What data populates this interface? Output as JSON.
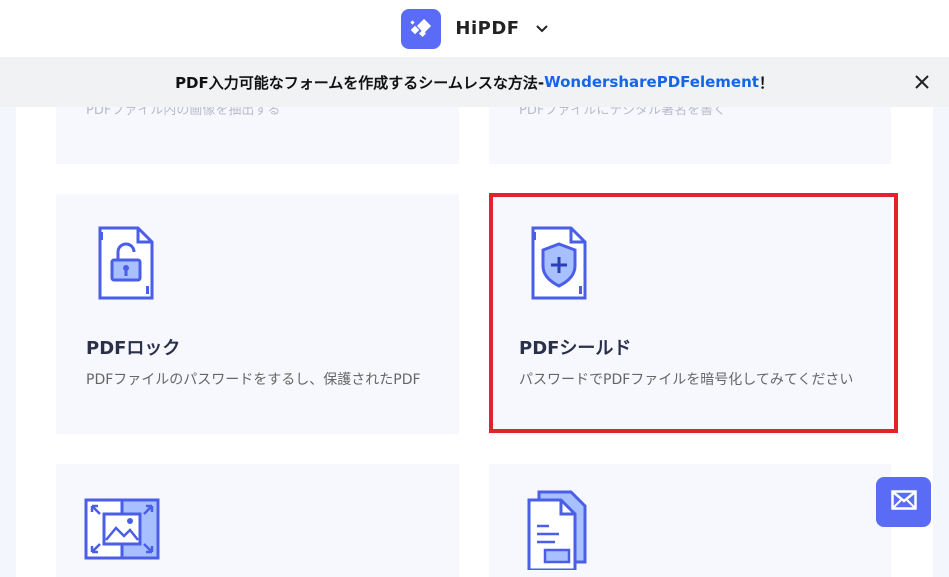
{
  "header": {
    "brand_name": "HiPDF"
  },
  "banner": {
    "text_prefix": "PDF入力可能なフォームを作成するシームレスな方法-",
    "link_text": "WondersharePDFelement",
    "text_suffix": "！"
  },
  "cards": {
    "top_left_desc": "PDFファイル内の画像を抽出する",
    "top_right_desc": "PDFファイルにデジタル署名を書く",
    "lock": {
      "title": "PDFロック",
      "desc": "PDFファイルのパスワードをするし、保護されたPDF"
    },
    "shield": {
      "title": "PDFシールド",
      "desc": "パスワードでPDFファイルを暗号化してみてください"
    }
  },
  "colors": {
    "accent": "#5a6cf5",
    "highlight": "#e0242e",
    "link": "#1565e8"
  },
  "icons": {
    "brand": "hipdf-logo-icon",
    "dropdown": "chevron-down-icon",
    "close": "close-icon",
    "lock": "pdf-lock-icon",
    "shield": "pdf-shield-icon",
    "resize": "image-resize-icon",
    "doc": "document-icon",
    "mail": "mail-icon"
  }
}
